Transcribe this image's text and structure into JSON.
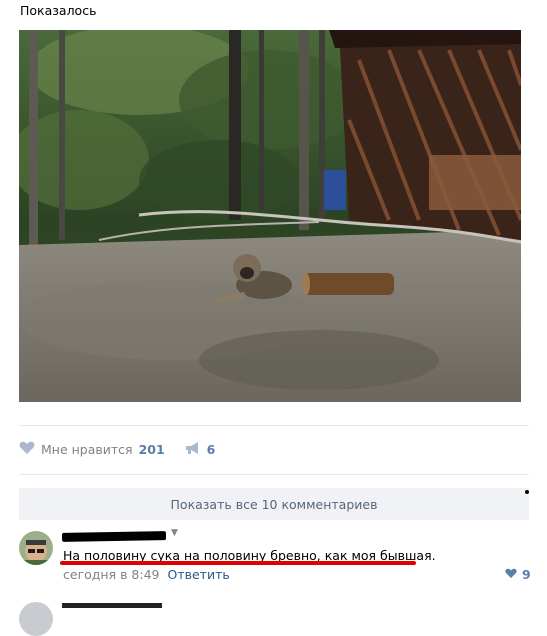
{
  "post": {
    "text": "Показалось"
  },
  "actions": {
    "like_label": "Мне нравится",
    "like_count": "201",
    "share_count": "6"
  },
  "comments": {
    "show_all_label": "Показать все 10 комментариев",
    "items": [
      {
        "text": "На половину сука на половину бревно, как моя бывшая.",
        "time": "сегодня в 8:49",
        "reply_label": "Ответить",
        "likes": "9"
      }
    ]
  },
  "colors": {
    "accent_blue": "#5b7ea8",
    "link_blue": "#2a5885",
    "gray": "#828282",
    "button_bg": "#f0f2f5",
    "highlight_red": "#e00000"
  },
  "icons": {
    "like": "heart-icon",
    "share": "megaphone-icon",
    "dropdown": "caret-down-icon"
  }
}
